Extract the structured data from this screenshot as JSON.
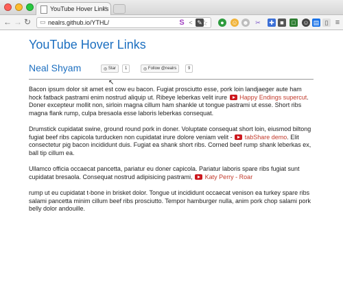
{
  "browser": {
    "tab_title": "YouTube Hover Links",
    "tab_close": "×",
    "url": "nealrs.github.io/YTHL/"
  },
  "page": {
    "title": "YouTube Hover Links",
    "author": "Neal Shyam",
    "star_label": "Star",
    "star_count": "1",
    "follow_label": "Follow @nealrs",
    "follow_count": "9"
  },
  "paragraphs": {
    "p1_a": "Bacon ipsum dolor sit amet est cow eu bacon. Fugiat prosciutto esse, pork loin landjaeger aute ham hock fatback pastrami enim nostrud aliquip ut. Ribeye leberkas velit irure",
    "p1_link": "Happy Endings supercut",
    "p1_b": ". Doner excepteur mollit non, sirloin magna cillum ham shankle ut tongue pastrami ut esse. Short ribs magna flank rump, culpa bresaola esse laboris leberkas consequat.",
    "p2_a": "Drumstick cupidatat swine, ground round pork in doner. Voluptate consequat short loin, eiusmod biltong fugiat beef ribs capicola turducken non cupidatat irure dolore veniam velit -",
    "p2_link": "tabShare demo",
    "p2_b": ". Elit consectetur pig bacon incididunt duis. Fugiat ea shank short ribs. Corned beef rump shank leberkas ex, ball tip cillum ea.",
    "p3_a": "Ullamco officia occaecat pancetta, pariatur eu doner capicola. Pariatur laboris spare ribs fugiat sunt cupidatat bresaola. Consequat nostrud adipisicing pastrami,",
    "p3_link": "Katy Perry - Roar",
    "p4": "rump ut eu cupidatat t-bone in brisket dolor. Tongue ut incididunt occaecat venison ea turkey spare ribs salami pancetta minim cillum beef ribs prosciutto. Tempor hamburger nulla, anim pork chop salami pork belly dolor andouille."
  },
  "colors": {
    "heading": "#1c6fc0",
    "link": "#c0392b",
    "youtube": "#cc181e"
  }
}
